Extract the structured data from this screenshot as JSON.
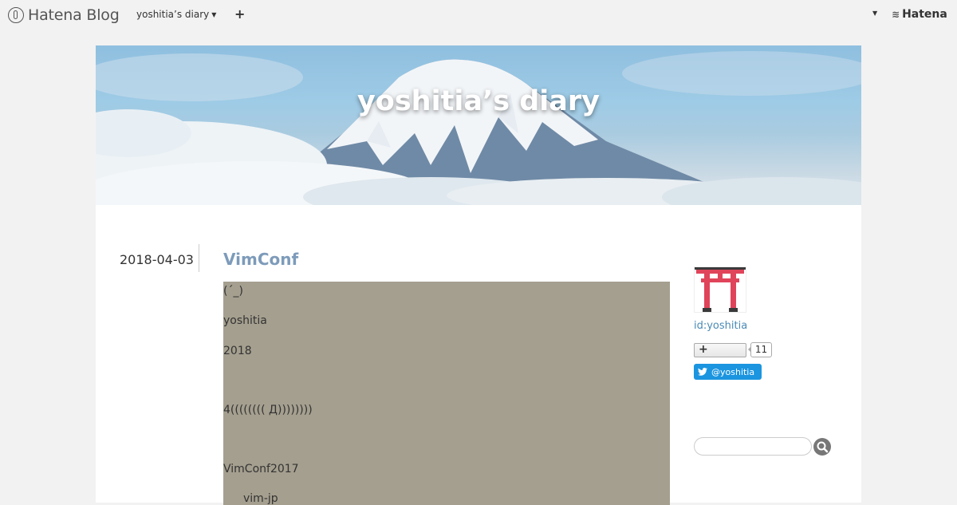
{
  "topbar": {
    "brand": "Hatena Blog",
    "blog_menu": "yoshitia’s diary",
    "add_label": "+",
    "hatena": "Hatena"
  },
  "header": {
    "title": "yoshitia’s diary"
  },
  "entry": {
    "date": "2018-04-03",
    "title": "VimConf",
    "lines": [
      "(´_)",
      "yoshitia",
      "2018",
      "4(((((((( Д))))))))",
      "VimConf2017",
      "vim-jp"
    ]
  },
  "sidebar": {
    "user_id": "id:yoshitia",
    "follow_label": "+",
    "follow_count": "11",
    "twitter_label": "@yoshitia"
  },
  "colors": {
    "title_link": "#7d9bba",
    "entry_bg": "#a59f8f",
    "twitter": "#1b95e0",
    "torii": "#e0445a"
  }
}
